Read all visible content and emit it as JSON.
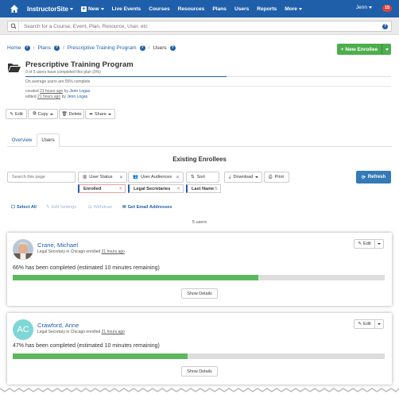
{
  "nav": {
    "brand": "InstructorSite",
    "new_label": "New",
    "items": [
      "Live Events",
      "Courses",
      "Resources",
      "Plans",
      "Users",
      "Reports"
    ],
    "more_label": "More",
    "user_name": "Jenn",
    "notification_count": "15",
    "brand_color": "#1f5faa"
  },
  "search": {
    "placeholder": "Search for a Course, Event, Plan, Resource, User, etc"
  },
  "breadcrumb": {
    "home": "Home",
    "plans": "Plans",
    "plan": "Prescriptive Training Program",
    "current": "Users"
  },
  "new_enrollee_label": "New Enrollee",
  "plan": {
    "title": "Prescriptive Training Program",
    "completion_summary": "0 of 5 users have completed this plan (0%)",
    "average_text": "On average users are 55% complete",
    "average_fraction": 0.55,
    "created_prefix": "created",
    "created_time": "21 hours ago",
    "created_by_prefix": "by",
    "created_by": "Jenn Logas",
    "edited_prefix": "edited",
    "edited_time": "21 hours ago",
    "edited_by_prefix": "by",
    "edited_by": "Jenn Logas"
  },
  "actions": {
    "edit": "Edit",
    "copy": "Copy",
    "delete": "Delete",
    "share": "Share"
  },
  "tabs": {
    "overview": "Overview",
    "users": "Users"
  },
  "section_title": "Existing Enrollees",
  "filters": {
    "search_placeholder": "Search this page",
    "user_status": "User Status",
    "user_audiences": "User Audiences",
    "sort": "Sort",
    "download": "Download",
    "print": "Print",
    "refresh": "Refresh",
    "chip_enrolled": "Enrolled",
    "chip_secretaries": "Legal Secretaries",
    "chip_lastname": "Last Name"
  },
  "bulk": {
    "select_all": "Select All",
    "edit_settings": "Edit Settings",
    "withdraw": "Withdraw",
    "get_emails": "Get Email Addresses"
  },
  "user_count": "5 users",
  "enrollees": [
    {
      "name": "Crane, Michael",
      "sub_prefix": "Legal Secretary in Chicago enrolled",
      "enrolled_time": "21 hours ago",
      "progress_text": "66% has been completed (estimated 10 minutes remaining)",
      "progress": 0.66,
      "edit_label": "Edit",
      "details_label": "Show Details"
    },
    {
      "name": "Crawford, Anne",
      "initials": "AC",
      "sub_prefix": "Legal Secretary in Chicago enrolled",
      "enrolled_time": "21 hours ago",
      "progress_text": "47% has been completed (estimated 10 minutes remaining)",
      "progress": 0.47,
      "edit_label": "Edit",
      "details_label": "Show Details"
    }
  ]
}
